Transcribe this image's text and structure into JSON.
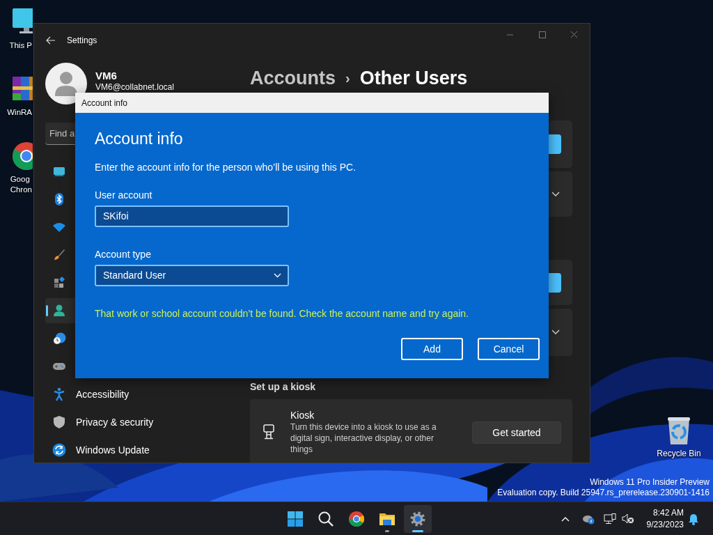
{
  "desktop": {
    "icons": [
      {
        "label": [
          "This P"
        ]
      },
      {
        "label": [
          "WinRA"
        ]
      },
      {
        "label": [
          "Goog",
          "Chron"
        ]
      }
    ],
    "recycle_bin": {
      "label": "Recycle Bin"
    },
    "watermark": [
      "Windows 11 Pro Insider Preview",
      "Evaluation copy. Build 25947.rs_prerelease.230901-1416"
    ]
  },
  "settings_window": {
    "title": "Settings",
    "profile": {
      "name": "VM6",
      "email": "VM6@collabnet.local"
    },
    "search": {
      "placeholder": "Find a"
    },
    "nav_items": [
      {
        "selected": false
      },
      {
        "selected": false
      },
      {
        "selected": false
      },
      {
        "selected": false
      },
      {
        "selected": false
      },
      {
        "selected": true
      },
      {
        "selected": false
      },
      {
        "selected": false
      },
      {
        "label": "Accessibility",
        "selected": false
      },
      {
        "label": "Privacy & security",
        "selected": false
      },
      {
        "label": "Windows Update",
        "selected": false
      }
    ],
    "breadcrumb": {
      "parent": "Accounts",
      "separator": "›",
      "current": "Other Users"
    },
    "background_cards": [
      {
        "kind": "button"
      },
      {
        "kind": "expander"
      },
      {
        "kind": "button"
      },
      {
        "kind": "expander"
      }
    ],
    "kiosk_section": {
      "heading": "Set up a kiosk",
      "title": "Kiosk",
      "description": "Turn this device into a kiosk to use as a digital sign, interactive display, or other things",
      "button": "Get started"
    }
  },
  "dialog": {
    "title": "Account info",
    "heading": "Account info",
    "description": "Enter the account info for the person who’ll be using this PC.",
    "user_account": {
      "label": "User account",
      "value": "SKifoi"
    },
    "account_type": {
      "label": "Account type",
      "value": "Standard User"
    },
    "error": "That work or school account couldn’t be found. Check the account name and try again.",
    "buttons": [
      "Add",
      "Cancel"
    ]
  },
  "taskbar": {
    "apps": [
      {
        "selected": false,
        "running": false
      },
      {
        "selected": false,
        "running": false
      },
      {
        "selected": false,
        "running": false
      },
      {
        "selected": false,
        "running": true
      },
      {
        "selected": true,
        "running": true
      }
    ],
    "clock": {
      "time": "8:42 AM",
      "date": "9/23/2023"
    }
  }
}
